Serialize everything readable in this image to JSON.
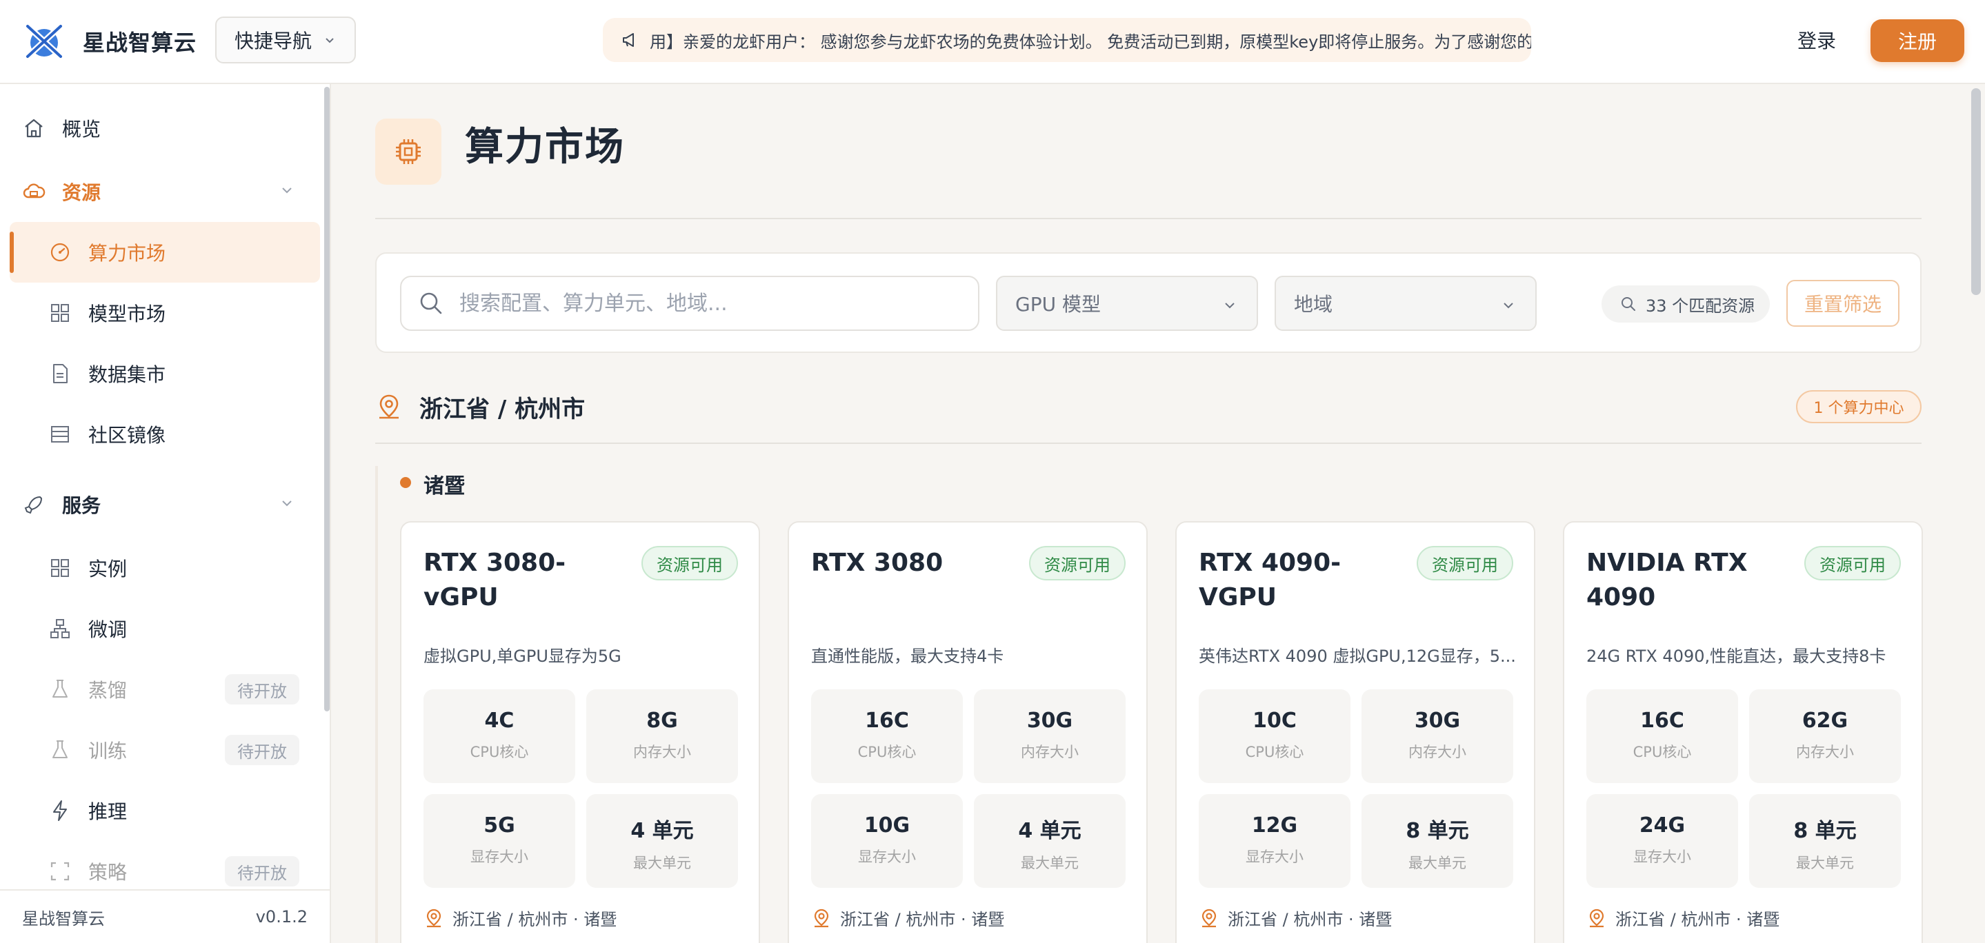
{
  "brand": {
    "name": "星战智算云"
  },
  "header": {
    "quick_nav": "快捷导航",
    "notice": "用】亲爱的龙虾用户： 感谢您参与龙虾农场的免费体验计划。 免费活动已到期，原模型key即将停止服务。为了感谢您的",
    "login": "登录",
    "register": "注册"
  },
  "sidebar": {
    "overview": "概览",
    "resources": {
      "label": "资源",
      "items": [
        "算力市场",
        "模型市场",
        "数据集市",
        "社区镜像"
      ]
    },
    "services": {
      "label": "服务",
      "items": [
        {
          "label": "实例",
          "pending": ""
        },
        {
          "label": "微调",
          "pending": ""
        },
        {
          "label": "蒸馏",
          "pending": "待开放"
        },
        {
          "label": "训练",
          "pending": "待开放"
        },
        {
          "label": "推理",
          "pending": ""
        },
        {
          "label": "策略",
          "pending": "待开放"
        }
      ]
    },
    "footer": {
      "name": "星战智算云",
      "version": "v0.1.2"
    }
  },
  "page": {
    "title": "算力市场"
  },
  "filters": {
    "search_placeholder": "搜索配置、算力单元、地域...",
    "gpu_model": "GPU 模型",
    "region": "地域",
    "match_count": "33 个匹配资源",
    "reset": "重置筛选"
  },
  "region": {
    "title": "浙江省 / 杭州市",
    "center_count": "1 个算力中心",
    "sub": "诸暨"
  },
  "cards": [
    {
      "name": "RTX 3080-vGPU",
      "status": "资源可用",
      "desc": "虚拟GPU,单GPU显存为5G",
      "specs": [
        {
          "value": "4C",
          "label": "CPU核心"
        },
        {
          "value": "8G",
          "label": "内存大小"
        },
        {
          "value": "5G",
          "label": "显存大小"
        },
        {
          "value": "4 单元",
          "label": "最大单元"
        }
      ],
      "location": "浙江省 / 杭州市 · 诸暨"
    },
    {
      "name": "RTX 3080",
      "status": "资源可用",
      "desc": "直通性能版，最大支持4卡",
      "specs": [
        {
          "value": "16C",
          "label": "CPU核心"
        },
        {
          "value": "30G",
          "label": "内存大小"
        },
        {
          "value": "10G",
          "label": "显存大小"
        },
        {
          "value": "4 单元",
          "label": "最大单元"
        }
      ],
      "location": "浙江省 / 杭州市 · 诸暨"
    },
    {
      "name": "RTX 4090-VGPU",
      "status": "资源可用",
      "desc": "英伟达RTX 4090 虚拟GPU,12G显存，5...",
      "specs": [
        {
          "value": "10C",
          "label": "CPU核心"
        },
        {
          "value": "30G",
          "label": "内存大小"
        },
        {
          "value": "12G",
          "label": "显存大小"
        },
        {
          "value": "8 单元",
          "label": "最大单元"
        }
      ],
      "location": "浙江省 / 杭州市 · 诸暨"
    },
    {
      "name": "NVIDIA RTX 4090",
      "status": "资源可用",
      "desc": "24G RTX 4090,性能直达，最大支持8卡",
      "specs": [
        {
          "value": "16C",
          "label": "CPU核心"
        },
        {
          "value": "62G",
          "label": "内存大小"
        },
        {
          "value": "24G",
          "label": "显存大小"
        },
        {
          "value": "8 单元",
          "label": "最大单元"
        }
      ],
      "location": "浙江省 / 杭州市 · 诸暨"
    }
  ],
  "colors": {
    "accent": "#e07a2e",
    "available": "#2f8a46"
  }
}
